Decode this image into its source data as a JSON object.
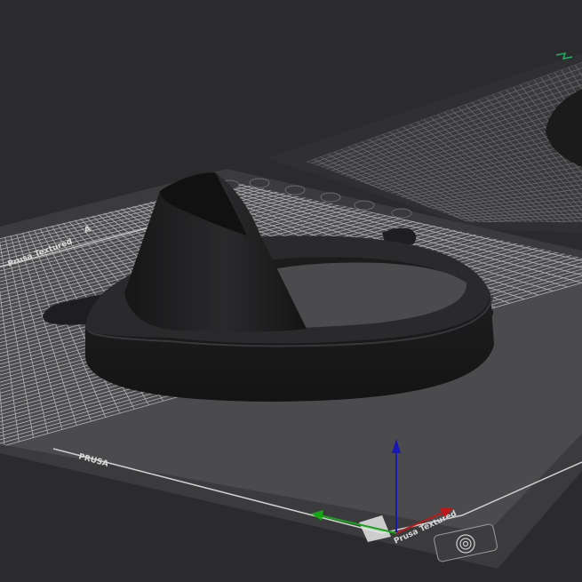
{
  "app": {
    "name": "",
    "view": "3d-viewport"
  },
  "scene": {
    "objects": [
      {
        "id": "model-1",
        "description": "",
        "color": "#1d1d1e"
      }
    ],
    "beds": [
      {
        "id": "bed-front",
        "active": true
      },
      {
        "id": "bed-back",
        "active": false
      }
    ],
    "bed_labels": {
      "front_left": "Prusa Textured",
      "front_right": "Prusa Textured",
      "front_logo": "PRUSA",
      "edge_letter": "A"
    },
    "bed_gizmo_icons": [
      "plate-icon-1",
      "plate-icon-2",
      "plate-icon-3",
      "plate-icon-4",
      "plate-icon-5",
      "plate-icon-6"
    ],
    "axes": {
      "x_color": "#c01818",
      "y_color": "#14a614",
      "z_color": "#1818b8"
    },
    "colors": {
      "background": "#2b2b2d",
      "bed_surface": "#4a4a4c",
      "bed_frame": "#3a3a3c",
      "grid_line": "#b9b9b9",
      "model": "#1d1d1e",
      "indicator": "#20b060"
    }
  }
}
